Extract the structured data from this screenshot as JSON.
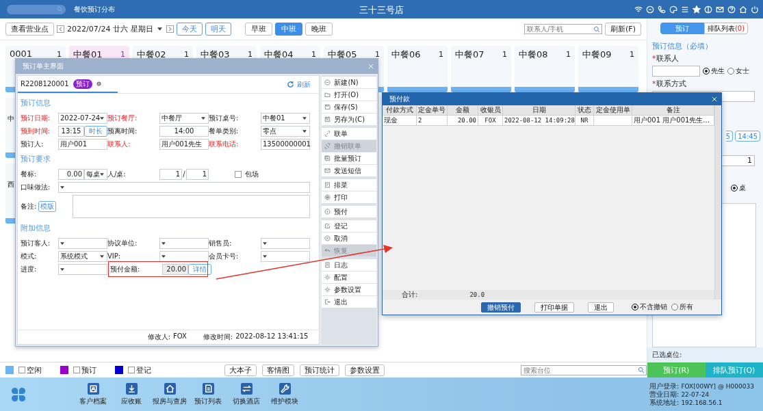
{
  "header": {
    "subtitle": "餐饮预订分布",
    "title": "三十三号店"
  },
  "toolbar": {
    "outlet_button": "查看营业点",
    "date": "2022/07/24",
    "lunar": "廿六",
    "weekday": "星期日",
    "quick_dates": [
      "今天",
      "明天"
    ],
    "shifts": [
      {
        "label": "早班",
        "selected": false
      },
      {
        "label": "中班",
        "selected": true
      },
      {
        "label": "晚班",
        "selected": false
      }
    ],
    "search": {
      "placeholder": "联系人/手机"
    },
    "refresh": "刷新(F)"
  },
  "table_rows": [
    {
      "cards": [
        {
          "name": "0001",
          "count": "1",
          "selected": false
        },
        {
          "name": "中餐01",
          "count": "1",
          "selected": true
        },
        {
          "name": "中餐02",
          "count": "1",
          "selected": false
        },
        {
          "name": "中餐03",
          "count": "1",
          "selected": false
        },
        {
          "name": "中餐04",
          "count": "1",
          "selected": false
        },
        {
          "name": "中餐05",
          "count": "1",
          "selected": false
        },
        {
          "name": "中餐06",
          "count": "1",
          "selected": false
        },
        {
          "name": "中餐07",
          "count": "1",
          "selected": false
        },
        {
          "name": "中餐08",
          "count": "1",
          "selected": false
        },
        {
          "name": "中餐09",
          "count": "1",
          "selected": false
        }
      ]
    },
    {
      "cards": [
        {
          "name": "中",
          "selected": false
        }
      ]
    },
    {
      "cards": [
        {
          "name": "西",
          "selected": false
        }
      ]
    }
  ],
  "legend": [
    {
      "label": "空闲",
      "color": "#6cb4f5",
      "checked": false
    },
    {
      "label": "预订",
      "color": "#9900cc",
      "checked": false
    },
    {
      "label": "登记",
      "color": "#0000cc",
      "checked": false
    }
  ],
  "legend_buttons": [
    "大本子",
    "客情图",
    "预订统计",
    "参数设置"
  ],
  "table_search": {
    "placeholder": "搜索台位"
  },
  "dock": [
    "客户档案",
    "应收账",
    "报房与查房",
    "预订列表",
    "切换酒店",
    "维护模块"
  ],
  "session": [
    {
      "label": "用户登录:",
      "value": "FOX[00WY] @ H000033"
    },
    {
      "label": "营业日期:",
      "value": "22-07-24"
    },
    {
      "label": "系统地址:",
      "value": "192.168.56.1"
    }
  ],
  "side_panel": {
    "tabs": [
      {
        "label": "预订",
        "selected": true
      },
      {
        "label": "排队列表",
        "count": "(0)",
        "selected": false
      }
    ],
    "section_title": "预订信息（必填）",
    "required_mark": "*",
    "contact_label": "联系人",
    "salutations": [
      {
        "label": "先生",
        "selected": true
      },
      {
        "label": "女士",
        "selected": false
      }
    ],
    "phone_label": "联系方式",
    "time_slots": [
      "5",
      "14:45"
    ],
    "count_value": "1",
    "table_unit": {
      "label": "桌",
      "selected": true
    },
    "selected_tables_label": "已选桌位:",
    "buttons": [
      {
        "label": "预订(R)",
        "kind": "book"
      },
      {
        "label": "排队预订(Q)",
        "kind": "queue"
      }
    ]
  },
  "booking_dialog": {
    "title": "预订单主界面",
    "order_no": "R2208120001",
    "status_badge": "预订",
    "refresh": "刷新",
    "sections": [
      {
        "title": "预订信息",
        "fields": [
          {
            "kind": "select",
            "label": "预订日期:",
            "required": true,
            "value": "2022-07-24"
          },
          {
            "kind": "select",
            "label": "预订餐厅:",
            "required": true,
            "value": "中餐厅"
          },
          {
            "kind": "select",
            "label": "预订桌号:",
            "required": false,
            "value": "中餐01"
          },
          {
            "kind": "time",
            "label": "预到时间:",
            "required": true,
            "value": "13:15",
            "button": "时长"
          },
          {
            "kind": "time",
            "label": "预离时间:",
            "required": false,
            "value": "14:00"
          },
          {
            "kind": "select",
            "label": "餐单类别:",
            "required": false,
            "value": "零点"
          },
          {
            "kind": "text",
            "label": "预订人:",
            "required": false,
            "value": "用户001"
          },
          {
            "kind": "text",
            "label": "联系人:",
            "required": true,
            "value": "用户001先生"
          },
          {
            "kind": "text",
            "label": "联系电话:",
            "required": true,
            "value": "13500000001"
          }
        ]
      },
      {
        "title": "预订要求",
        "fields": [
          {
            "kind": "price",
            "label": "餐标:",
            "required": false,
            "value": "0.00",
            "unit": "每桌"
          },
          {
            "kind": "ratio",
            "label": "人/桌:",
            "required": false,
            "values": [
              "1",
              "1"
            ],
            "separator": "/"
          },
          {
            "kind": "checkbox",
            "label": "包场",
            "checked": false
          },
          {
            "kind": "wide-select",
            "label": "口味做法:",
            "required": false
          },
          {
            "kind": "note",
            "label": "备注:",
            "required": false,
            "button": "模版"
          }
        ]
      },
      {
        "title": "附加信息",
        "fields": [
          {
            "kind": "select",
            "label": "预订客人:",
            "required": false
          },
          {
            "kind": "select",
            "label": "协议单位:",
            "required": false
          },
          {
            "kind": "select",
            "label": "销售员:",
            "required": false
          },
          {
            "kind": "select",
            "label": "模式:",
            "required": false,
            "value": "系统模式"
          },
          {
            "kind": "select",
            "label": "VIP:",
            "required": false
          },
          {
            "kind": "select",
            "label": "会员卡号:",
            "required": false
          },
          {
            "kind": "select",
            "label": "进度:",
            "required": false
          },
          {
            "kind": "prepay",
            "label": "预付金额:",
            "required": false,
            "value": "20.00",
            "button": "详情",
            "highlighted": true
          }
        ]
      }
    ],
    "menu": [
      [
        {
          "label": "新建(N)",
          "disabled": false
        },
        {
          "label": "打开(O)",
          "disabled": false
        },
        {
          "label": "保存(S)",
          "disabled": false
        },
        {
          "label": "另存为(C)",
          "disabled": false
        }
      ],
      [
        {
          "label": "联单",
          "disabled": false
        },
        {
          "label": "撤销联单",
          "disabled": true
        },
        {
          "label": "批量预订",
          "disabled": false
        },
        {
          "label": "发送短信",
          "disabled": false
        }
      ],
      [
        {
          "label": "排菜",
          "disabled": false
        },
        {
          "label": "打印",
          "disabled": false
        }
      ],
      [
        {
          "label": "预付",
          "disabled": false
        }
      ],
      [
        {
          "label": "登记",
          "disabled": false
        },
        {
          "label": "取消",
          "disabled": false
        },
        {
          "label": "恢复",
          "disabled": true
        }
      ],
      [
        {
          "label": "日志",
          "disabled": false
        },
        {
          "label": "配置",
          "disabled": false
        },
        {
          "label": "参数设置",
          "disabled": false
        },
        {
          "label": "退出",
          "disabled": false
        }
      ]
    ],
    "footer": [
      {
        "label": "修改人:",
        "value": "FOX"
      },
      {
        "label": "修改时间:",
        "value": "2022-08-12 13:41:15"
      }
    ]
  },
  "prepay_dialog": {
    "title": "预付款",
    "columns": [
      "付款方式",
      "定金单号",
      "金额",
      "收银员",
      "日期",
      "状态",
      "定金使用单",
      "备注"
    ],
    "rows": [
      [
        "现金",
        "2",
        "20.00",
        "FOX",
        "2022-08-12 14:09:28",
        "NR",
        null,
        "用户001 用户001先生..."
      ]
    ],
    "total_label": "合计:",
    "total_value": "20.0",
    "buttons": [
      {
        "label": "撤销预付",
        "primary": true
      },
      {
        "label": "打印单据",
        "primary": false
      },
      {
        "label": "退出",
        "primary": false
      }
    ],
    "filters": [
      {
        "label": "不含撤销",
        "selected": true
      },
      {
        "label": "所有",
        "selected": false
      }
    ]
  }
}
